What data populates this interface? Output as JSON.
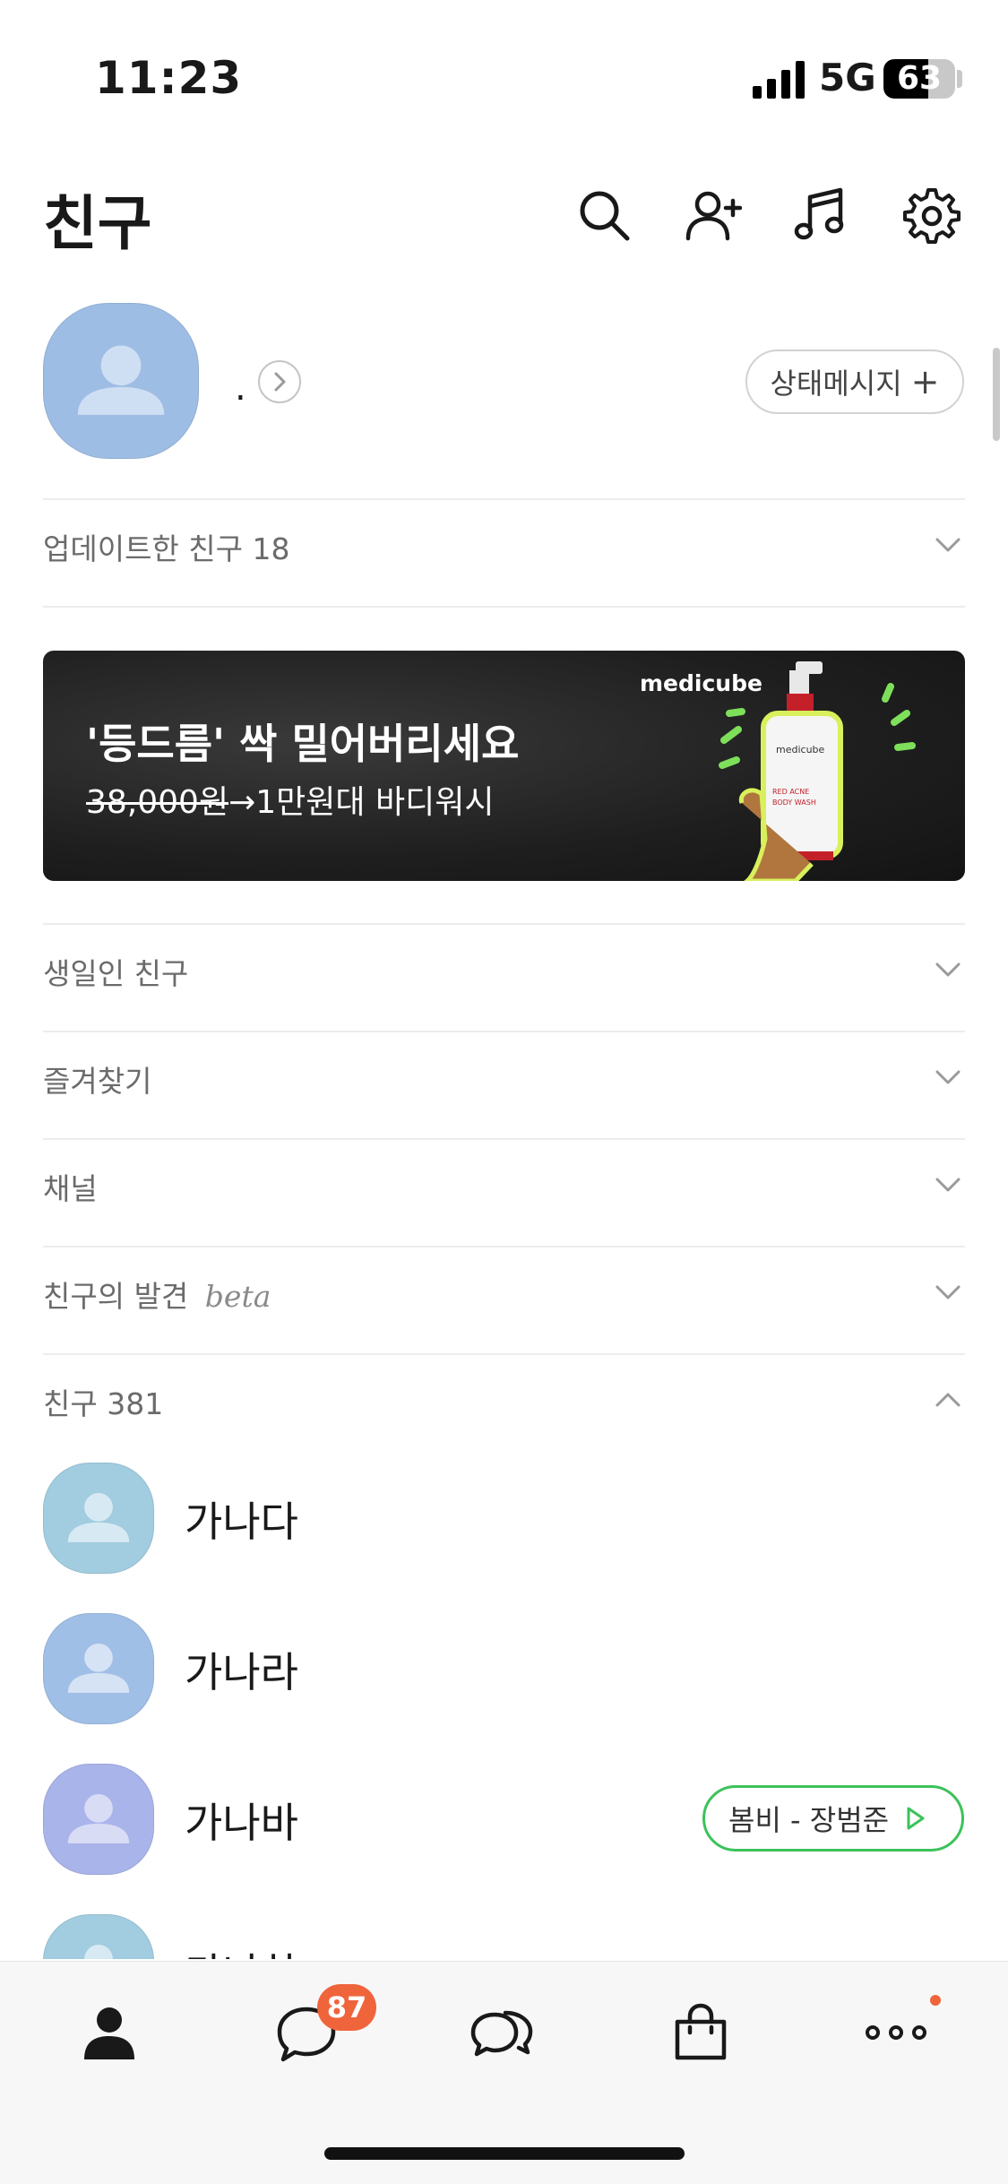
{
  "status_bar": {
    "time": "11:23",
    "network": "5G",
    "battery": "63",
    "battery_level": 0.63
  },
  "header": {
    "title": "친구",
    "icons": [
      "search-icon",
      "add-friend-icon",
      "music-icon",
      "settings-icon"
    ]
  },
  "profile": {
    "name": ".",
    "status_button": "상태메시지",
    "status_button_plus": "+"
  },
  "sections": {
    "updated_friends": "업데이트한 친구 18",
    "birthday": "생일인 친구",
    "favorites": "즐겨찾기",
    "channel": "채널",
    "discover": "친구의 발견",
    "discover_beta": "beta",
    "friends": "친구 381"
  },
  "banner": {
    "title": "'등드름' 싹 밀어버리세요",
    "price_old": "38,000원",
    "price_new": "→1만원대 바디워시",
    "brand": "medicube",
    "product_label_1": "medicube",
    "product_label_2": "RED ACNE",
    "product_label_3": "BODY WASH"
  },
  "friends": [
    {
      "name": "가나다",
      "avatar_color": "#a2cce0"
    },
    {
      "name": "가나라",
      "avatar_color": "#a0bfe6"
    },
    {
      "name": "가나바",
      "avatar_color": "#a9b4ea",
      "music": "봄비 - 장범준"
    },
    {
      "name": "가나하",
      "avatar_color": "#a2cce0"
    }
  ],
  "tabbar": {
    "items": [
      "friends-tab",
      "chats-tab",
      "openchat-tab",
      "shopping-tab",
      "more-tab"
    ],
    "chat_badge": "87"
  },
  "colors": {
    "accent_orange": "#f0643c",
    "music_green": "#3cc25a",
    "avatar_blue": "#9ebde4"
  }
}
